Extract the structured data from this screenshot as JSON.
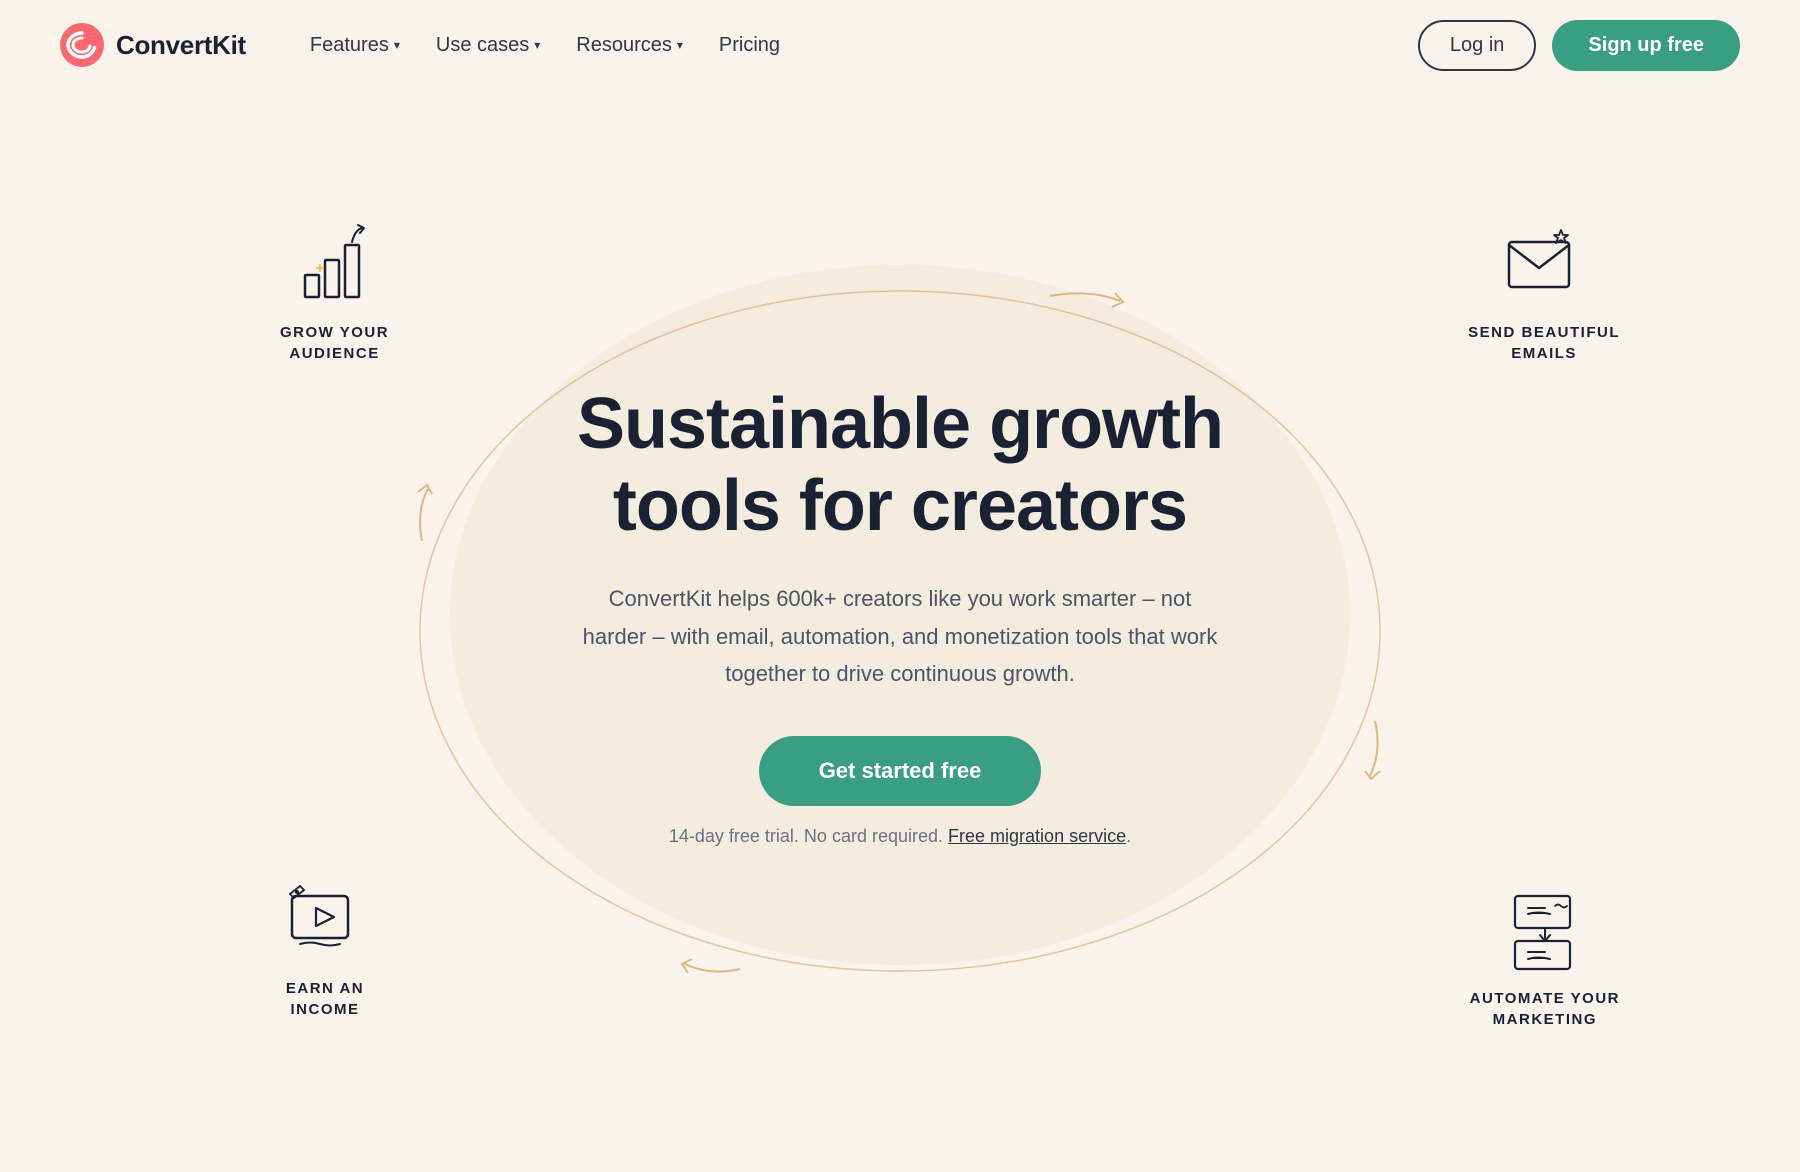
{
  "nav": {
    "logo_text": "ConvertKit",
    "links": [
      {
        "label": "Features",
        "has_dropdown": true
      },
      {
        "label": "Use cases",
        "has_dropdown": true
      },
      {
        "label": "Resources",
        "has_dropdown": true
      },
      {
        "label": "Pricing",
        "has_dropdown": false
      }
    ],
    "login_label": "Log in",
    "signup_label": "Sign up free"
  },
  "hero": {
    "title": "Sustainable growth tools for creators",
    "subtitle": "ConvertKit helps 600k+ creators like you work smarter – not harder – with email, automation, and monetization tools that work together to drive continuous growth.",
    "cta_label": "Get started free",
    "trial_text": "14-day free trial. No card required.",
    "migration_label": "Free migration service"
  },
  "features": [
    {
      "id": "grow",
      "label": "GROW YOUR\nAUDIENCE",
      "icon": "chart-grow"
    },
    {
      "id": "email",
      "label": "SEND BEAUTIFUL\nEMAILS",
      "icon": "envelope-star"
    },
    {
      "id": "income",
      "label": "EARN AN\nINCOME",
      "icon": "video-card"
    },
    {
      "id": "automate",
      "label": "AUTOMATE YOUR\nMARKETING",
      "icon": "automation-screens"
    }
  ]
}
